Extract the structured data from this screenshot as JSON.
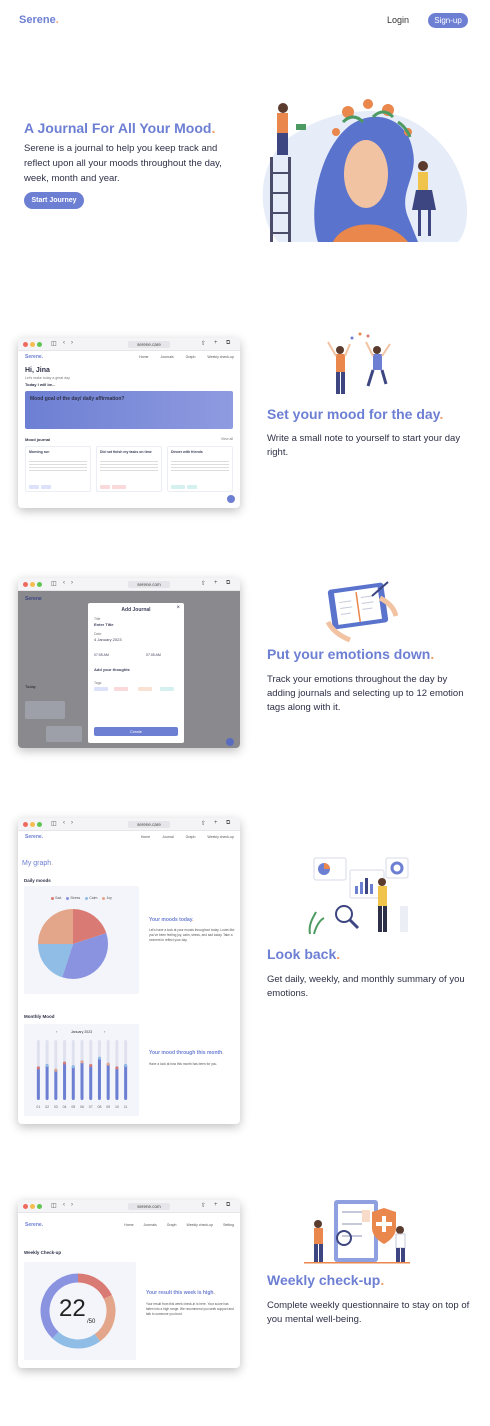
{
  "nav": {
    "logo": "Serene",
    "login": "Login",
    "signup": "Sign-up"
  },
  "hero": {
    "title": "A Journal For All Your Mood",
    "text": "Serene is a journal to help you keep track and reflect upon all your moods throughout the day, week, month and year.",
    "cta": "Start Journey"
  },
  "colors": {
    "accent": "#6d7fd3",
    "highlight": "#f0a06a",
    "text": "#2e3047"
  },
  "features": [
    {
      "title": "Set your mood for the day",
      "text": "Write a small note to yourself to start your day right."
    },
    {
      "title": "Put your emotions down",
      "text": "Track your emotions throughout the day by adding journals and selecting up to 12 emotion tags along with it."
    },
    {
      "title": "Look back",
      "text": "Get daily, weekly, and monthly summary of you emotions."
    },
    {
      "title": "Weekly check-up",
      "text": "Complete weekly questionnaire to stay on top of you mental well-being."
    }
  ],
  "shot1": {
    "url": "serene.care",
    "logo": "Serene.",
    "links": [
      "Home",
      "Journals",
      "Graph",
      "Weekly check-up"
    ],
    "greeting": "Hi, Jina",
    "date": "Let's make today a great day",
    "today_label": "Today I will be...",
    "banner": "Mood goal of the day/ daily affirmation?",
    "journal_label": "Mood journal",
    "view_all": "View all",
    "cards": [
      {
        "title": "Morning run",
        "tags": [
          "Excited",
          "Happy"
        ]
      },
      {
        "title": "Did not finish my tasks on time",
        "tags": [
          "Anxious",
          "Disappointed"
        ]
      },
      {
        "title": "Dinner with friends",
        "tags": [
          "Grateful",
          "Calm"
        ]
      }
    ]
  },
  "shot2": {
    "url": "serene.com",
    "logo": "Serene",
    "modal_title": "Add Journal",
    "title_label": "Title",
    "title_value": "Enter Title",
    "date_label": "Date",
    "date_value": "4 January 2023",
    "time_from": "07:05 AM",
    "time_to": "07:05 AM",
    "thoughts_label": "Add your thoughts",
    "tags_label": "Tags",
    "create": "Create",
    "today": "Today"
  },
  "shot3": {
    "url": "serene.care",
    "logo": "Serene.",
    "links": [
      "Home",
      "Journal",
      "Graph",
      "Weekly check-up"
    ],
    "page_title": "My graph",
    "daily_label": "Daily moods",
    "legend": [
      "Sad",
      "Stress",
      "Calm",
      "Joy"
    ],
    "today_heading": "Your moods today",
    "today_text": "Let's have a look at your moods throughout today. Looks like you've been feeling joy, calm, stress, and sad today. Take a moment to reflect your day.",
    "monthly_label": "Monthly Mood",
    "month": "January 2023",
    "month_heading": "Your mood through this month",
    "month_text": "Have a look at how this month has been for you."
  },
  "shot4": {
    "url": "serene.com",
    "logo": "Serene.",
    "links": [
      "Home",
      "Journals",
      "Graph",
      "Weekly check-up",
      "Setting"
    ],
    "section": "Weekly Check-up",
    "score": "22",
    "out_of": "/50",
    "heading": "Your result this week is high",
    "text": "Your result from this week check-in is here. Your score has fallen into a high range. We recommend you seek support and talk to someone you trust."
  },
  "chart_data": [
    {
      "type": "pie",
      "title": "Daily moods",
      "categories": [
        "Sad",
        "Stress",
        "Calm",
        "Joy"
      ],
      "values": [
        20,
        35,
        20,
        25
      ],
      "colors": [
        "#d97b74",
        "#8a93e0",
        "#8fbde6",
        "#e3a68a"
      ]
    },
    {
      "type": "bar",
      "title": "Monthly Mood",
      "categories": [
        "01",
        "02",
        "03",
        "04",
        "05",
        "06",
        "07",
        "08",
        "09",
        "10",
        "11"
      ],
      "series": [
        {
          "values": [
            28,
            30,
            26,
            32,
            29,
            33,
            30,
            36,
            31,
            28,
            30
          ]
        }
      ],
      "ylim": [
        0,
        50
      ]
    }
  ]
}
